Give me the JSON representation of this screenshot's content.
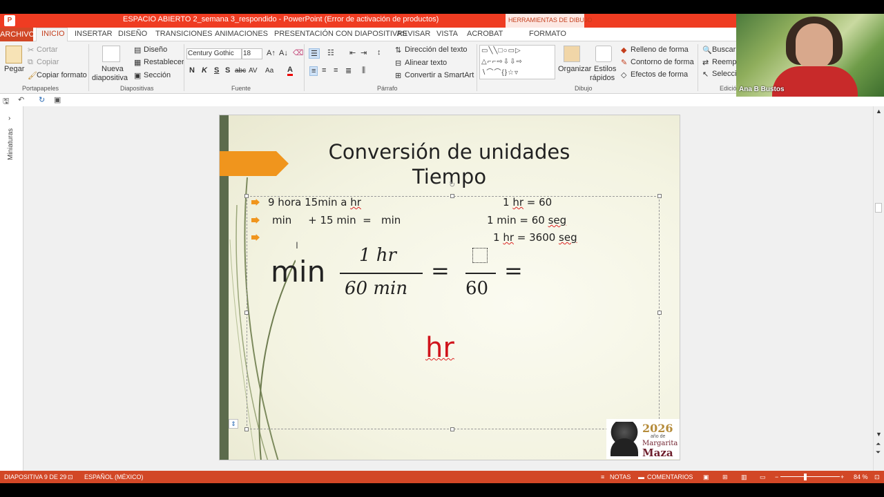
{
  "window": {
    "title": "ESPACIO ABIERTO 2_semana 3_respondido -  PowerPoint (Error de activación de productos)",
    "app_icon": "P",
    "context_tools": "HERRAMIENTAS DE DIBUJO"
  },
  "tabs": [
    "ARCHIVO",
    "INICIO",
    "INSERTAR",
    "DISEÑO",
    "TRANSICIONES",
    "ANIMACIONES",
    "PRESENTACIÓN CON DIAPOSITIVAS",
    "REVISAR",
    "VISTA",
    "ACROBAT",
    "FORMATO"
  ],
  "ribbon": {
    "clipboard": {
      "paste": "Pegar",
      "cut": "Cortar",
      "copy": "Copiar",
      "format_painter": "Copiar formato",
      "label": "Portapapeles"
    },
    "slides": {
      "new_slide_line1": "Nueva",
      "new_slide_line2": "diapositiva",
      "layout": "Diseño",
      "reset": "Restablecer",
      "section": "Sección",
      "label": "Diapositivas"
    },
    "font": {
      "name": "Century Gothic",
      "size": "18",
      "bold": "N",
      "italic": "K",
      "underline": "S",
      "shadow": "S",
      "strike": "abc",
      "spacing": "AV",
      "case": "Aa",
      "color": "A",
      "label": "Fuente"
    },
    "paragraph": {
      "text_direction": "Dirección del texto",
      "align_text": "Alinear texto",
      "smartart": "Convertir a SmartArt",
      "label": "Párrafo"
    },
    "drawing": {
      "arrange": "Organizar",
      "quick_styles_line1": "Estilos",
      "quick_styles_line2": "rápidos",
      "shape_fill": "Relleno de forma",
      "shape_outline": "Contorno de forma",
      "shape_effects": "Efectos de forma",
      "label": "Dibujo"
    },
    "editing": {
      "find": "Buscar",
      "replace": "Reemplaz",
      "select": "Seleccio",
      "label": "Edició"
    }
  },
  "thumbnails_label": "Miniaturas",
  "slide": {
    "title_line1": "Conversión de unidades",
    "title_line2": "Tiempo",
    "bullets": [
      {
        "part1": "9 hora 15min a ",
        "part2": "hr"
      },
      {
        "text": "min     + 15 min  =   min"
      },
      {
        "text": ""
      }
    ],
    "conversions": [
      {
        "part1": "1 ",
        "part2": "hr",
        "part3": " = 60"
      },
      {
        "part1": "1 min = 60 ",
        "part2": "seg"
      },
      {
        "part1": "1 ",
        "part2": "hr",
        "part3": " = 3600 ",
        "part4": "seg"
      }
    ],
    "equation": {
      "lead": "min",
      "num1": "1 hr",
      "den1": "60 min",
      "equals1": "=",
      "den2": "60",
      "equals2": "="
    },
    "answer": "hr",
    "logo": {
      "year": "2026",
      "sub": "año de",
      "name1": "Margarita",
      "name2": "Maza"
    }
  },
  "webcam": {
    "name": "Ana B Bustos"
  },
  "status": {
    "slide_count": "DIAPOSITIVA 9 DE 29",
    "language": "ESPAÑOL (MÉXICO)",
    "notes": "NOTAS",
    "comments": "COMENTARIOS",
    "zoom": "84 %"
  },
  "colors": {
    "accent": "#d24726",
    "titlebar": "#ef3c22",
    "slide_bar": "#5c6b4c",
    "bullet_orange": "#f0951d",
    "answer_red": "#d0141c"
  }
}
